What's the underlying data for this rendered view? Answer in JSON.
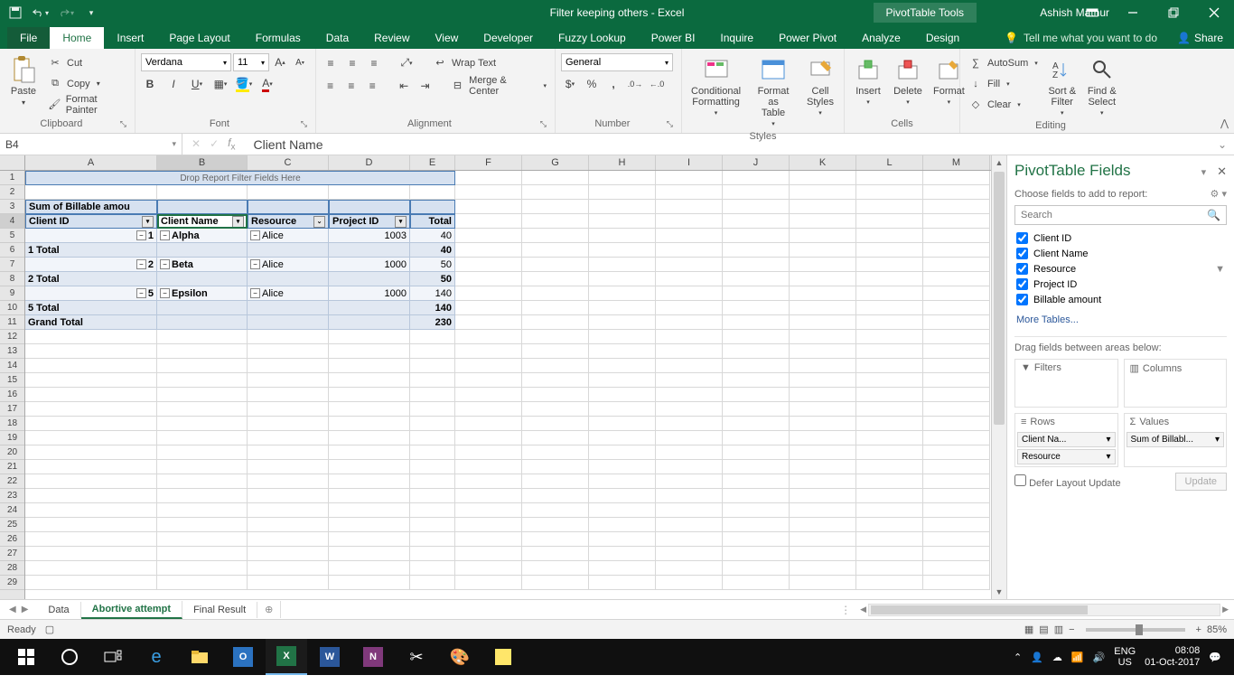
{
  "title": "Filter keeping others - Excel",
  "pivot_tools_label": "PivotTable Tools",
  "user": "Ashish Mathur",
  "tabs": {
    "file": "File",
    "home": "Home",
    "insert": "Insert",
    "pagelayout": "Page Layout",
    "formulas": "Formulas",
    "data": "Data",
    "review": "Review",
    "view": "View",
    "developer": "Developer",
    "fuzzy": "Fuzzy Lookup",
    "powerbi": "Power BI",
    "inquire": "Inquire",
    "powerpivot": "Power Pivot",
    "analyze": "Analyze",
    "design": "Design",
    "tellme": "Tell me what you want to do",
    "share": "Share"
  },
  "ribbon": {
    "paste": "Paste",
    "cut": "Cut",
    "copy": "Copy",
    "formatpainter": "Format Painter",
    "clipboard": "Clipboard",
    "font_name": "Verdana",
    "font_size": "11",
    "font_label": "Font",
    "wrap": "Wrap Text",
    "merge": "Merge & Center",
    "alignment": "Alignment",
    "numfmt": "General",
    "number": "Number",
    "condfmt": "Conditional\nFormatting",
    "fmttable": "Format as\nTable",
    "cellstyles": "Cell\nStyles",
    "styles": "Styles",
    "insert": "Insert",
    "delete": "Delete",
    "format": "Format",
    "cells": "Cells",
    "autosum": "AutoSum",
    "fill": "Fill",
    "clear": "Clear",
    "sortfilter": "Sort &\nFilter",
    "findselect": "Find &\nSelect",
    "editing": "Editing"
  },
  "namebox": "B4",
  "formula": "Client Name",
  "colheads": [
    "A",
    "B",
    "C",
    "D",
    "E",
    "F",
    "G",
    "H",
    "I",
    "J",
    "K",
    "L",
    "M"
  ],
  "pt": {
    "filter_hint": "Drop Report Filter Fields Here",
    "sumof": "Sum of Billable amou",
    "h_clientid": "Client ID",
    "h_clientname": "Client Name",
    "h_resource": "Resource",
    "h_projectid": "Project ID",
    "h_total": "Total",
    "r5_id": "1",
    "r5_cn": "Alpha",
    "r5_res": "Alice",
    "r5_pid": "1003",
    "r5_tot": "40",
    "r6": "1 Total",
    "r6_tot": "40",
    "r7_id": "2",
    "r7_cn": "Beta",
    "r7_res": "Alice",
    "r7_pid": "1000",
    "r7_tot": "50",
    "r8": "2 Total",
    "r8_tot": "50",
    "r9_id": "5",
    "r9_cn": "Epsilon",
    "r9_res": "Alice",
    "r9_pid": "1000",
    "r9_tot": "140",
    "r10": "5 Total",
    "r10_tot": "140",
    "r11": "Grand Total",
    "r11_tot": "230"
  },
  "ptfields": {
    "title": "PivotTable Fields",
    "choose": "Choose fields to add to report:",
    "search_ph": "Search",
    "fields": {
      "f1": "Client ID",
      "f2": "Client Name",
      "f3": "Resource",
      "f4": "Project ID",
      "f5": "Billable amount"
    },
    "more": "More Tables...",
    "drag": "Drag fields between areas below:",
    "filters": "Filters",
    "columns": "Columns",
    "rows": "Rows",
    "values": "Values",
    "r_clientname": "Client Na...",
    "r_resource": "Resource",
    "v_sum": "Sum of Billabl...",
    "defer": "Defer Layout Update",
    "update": "Update"
  },
  "sheets": {
    "data": "Data",
    "abortive": "Abortive attempt",
    "final": "Final Result"
  },
  "status": {
    "ready": "Ready",
    "zoom": "85%"
  },
  "tray": {
    "lang": "ENG",
    "region": "US",
    "time": "08:08",
    "date": "01-Oct-2017"
  }
}
